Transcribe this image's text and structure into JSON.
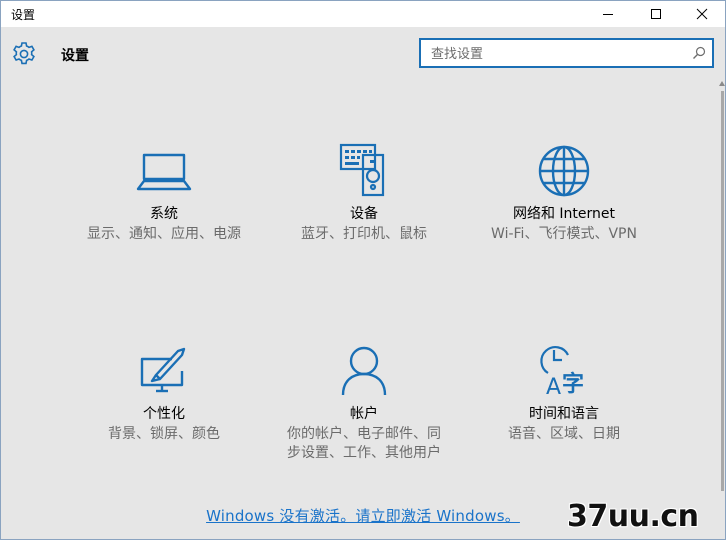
{
  "window": {
    "title": "设置",
    "controls": {
      "minimize": "minimize-icon",
      "maximize": "maximize-icon",
      "close": "close-icon"
    }
  },
  "header": {
    "title": "设置",
    "icon": "gear-icon",
    "search_placeholder": "查找设置"
  },
  "tiles": [
    {
      "name": "系统",
      "desc": "显示、通知、应用、电源",
      "icon": "laptop-icon"
    },
    {
      "name": "设备",
      "desc": "蓝牙、打印机、鼠标",
      "icon": "devices-icon"
    },
    {
      "name": "网络和 Internet",
      "desc": "Wi-Fi、飞行模式、VPN",
      "icon": "globe-icon"
    },
    {
      "name": "个性化",
      "desc": "背景、锁屏、颜色",
      "icon": "personalization-icon"
    },
    {
      "name": "帐户",
      "desc": "你的帐户、电子邮件、同步设置、工作、其他用户",
      "icon": "account-icon"
    },
    {
      "name": "时间和语言",
      "desc": "语音、区域、日期",
      "icon": "time-language-icon"
    }
  ],
  "activation_link": "Windows 没有激活。请立即激活 Windows。",
  "watermark": "37uu.cn",
  "colors": {
    "accent": "#1a73c9",
    "background": "#e6e6e6",
    "desc_text": "#6b6b6b"
  }
}
